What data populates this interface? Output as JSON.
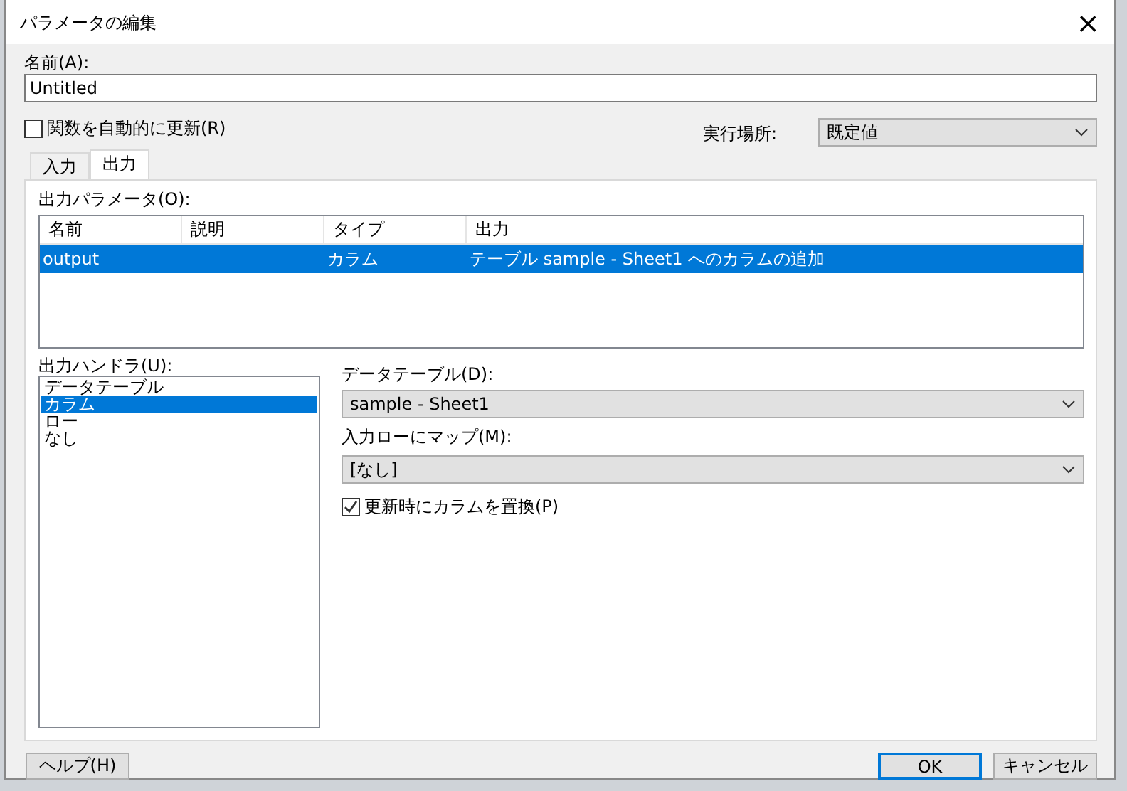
{
  "window": {
    "title": "パラメータの編集",
    "close": "×"
  },
  "name_field": {
    "label": "名前(A):",
    "value": "Untitled"
  },
  "auto_update": {
    "label": "関数を自動的に更新(R)",
    "checked": false
  },
  "run_location": {
    "label": "実行場所:",
    "value": "既定値"
  },
  "tabs": [
    {
      "label": "入力",
      "selected": false
    },
    {
      "label": "出力",
      "selected": true
    }
  ],
  "output_parameters": {
    "label": "出力パラメータ(O):",
    "columns": [
      "名前",
      "説明",
      "タイプ",
      "出力"
    ],
    "rows": [
      {
        "cells": [
          "output",
          "",
          "カラム",
          "テーブル sample - Sheet1 へのカラムの追加"
        ],
        "selected": true
      }
    ]
  },
  "output_handler": {
    "label": "出力ハンドラ(U):",
    "items": [
      {
        "label": "データテーブル",
        "selected": false
      },
      {
        "label": "カラム",
        "selected": true
      },
      {
        "label": "ロー",
        "selected": false
      },
      {
        "label": "なし",
        "selected": false
      }
    ]
  },
  "data_table": {
    "label": "データテーブル(D):",
    "value": "sample - Sheet1"
  },
  "map_to_row": {
    "label": "入力ローにマップ(M):",
    "value": "[なし]"
  },
  "replace_on_update": {
    "label": "更新時にカラムを置換(P)",
    "checked": true
  },
  "buttons": [
    {
      "label": "ヘルプ(H)",
      "kind": "help"
    },
    {
      "label": "OK",
      "kind": "default"
    },
    {
      "label": "キャンセル",
      "kind": "normal"
    }
  ]
}
